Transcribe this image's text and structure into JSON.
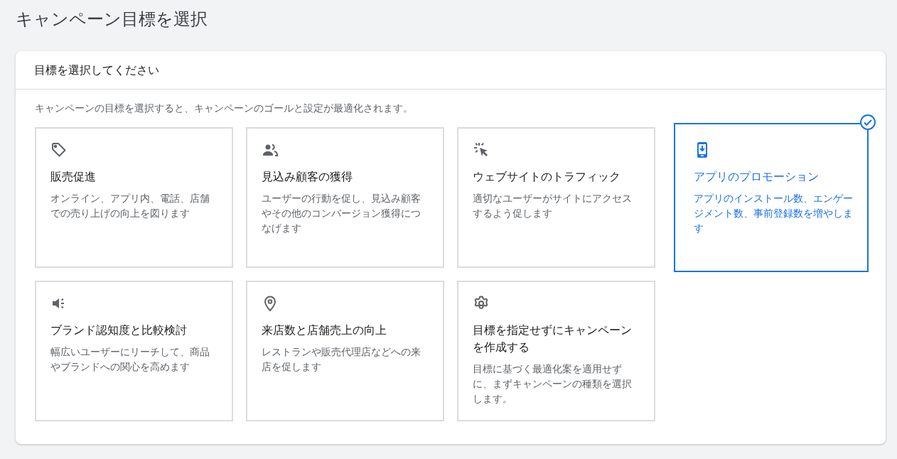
{
  "page_title": "キャンペーン目標を選択",
  "card": {
    "header": "目標を選択してください",
    "description": "キャンペーンの目標を選択すると、キャンペーンのゴールと設定が最適化されます。",
    "goals": [
      {
        "title": "販売促進",
        "description": "オンライン、アプリ内、電話、店舗での売り上げの向上を図ります",
        "selected": false
      },
      {
        "title": "見込み顧客の獲得",
        "description": "ユーザーの行動を促し、見込み顧客やその他のコンバージョン獲得につなげます",
        "selected": false
      },
      {
        "title": "ウェブサイトのトラフィック",
        "description": "適切なユーザーがサイトにアクセスするよう促します",
        "selected": false
      },
      {
        "title": "アプリのプロモーション",
        "description": "アプリのインストール数、エンゲージメント数、事前登録数を増やします",
        "selected": true
      },
      {
        "title": "ブランド認知度と比較検討",
        "description": "幅広いユーザーにリーチして、商品やブランドへの関心を高めます",
        "selected": false
      },
      {
        "title": "来店数と店舗売上の向上",
        "description": "レストランや販売代理店などへの来店を促します",
        "selected": false
      },
      {
        "title": "目標を指定せずにキャンペーンを作成する",
        "description": "目標に基づく最適化案を適用せずに、まずキャンペーンの種類を選択します。",
        "selected": false
      }
    ]
  }
}
